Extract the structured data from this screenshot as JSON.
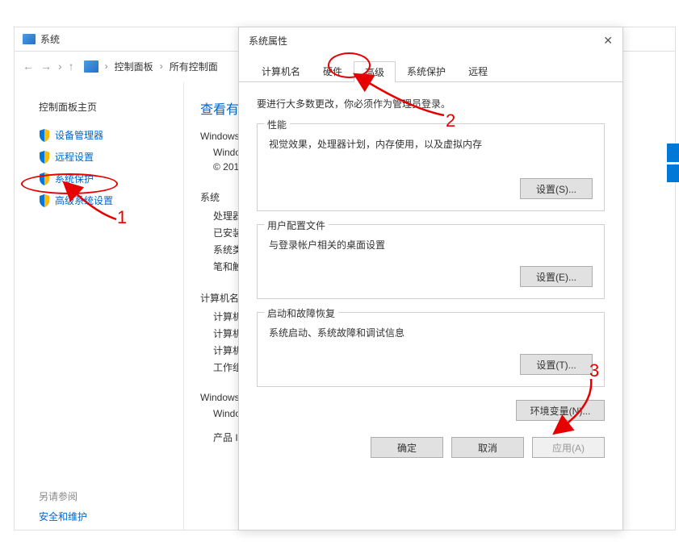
{
  "system_window": {
    "title": "系统",
    "breadcrumb": [
      "控制面板",
      "所有控制面"
    ]
  },
  "sidebar": {
    "home": "控制面板主页",
    "items": [
      {
        "label": "设备管理器"
      },
      {
        "label": "远程设置"
      },
      {
        "label": "系统保护"
      },
      {
        "label": "高级系统设置"
      }
    ],
    "see_also": "另请参阅",
    "see_also_link": "安全和维护"
  },
  "main": {
    "heading": "查看有关",
    "win_edition": "Windows",
    "win_sub1": "Windo",
    "win_sub2": "© 201",
    "system": "系统",
    "system_items": [
      "处理器",
      "已安装",
      "系统类",
      "笔和触"
    ],
    "computer": "计算机名、",
    "computer_items": [
      "计算机",
      "计算机",
      "计算机",
      "工作组"
    ],
    "activation": "Windows",
    "activation_sub": "Windo",
    "product": "产品 II"
  },
  "dialog": {
    "title": "系统属性",
    "tabs": [
      "计算机名",
      "硬件",
      "高级",
      "系统保护",
      "远程"
    ],
    "active_tab": 2,
    "note": "要进行大多数更改，你必须作为管理员登录。",
    "groups": [
      {
        "title": "性能",
        "desc": "视觉效果，处理器计划，内存使用，以及虚拟内存",
        "button": "设置(S)..."
      },
      {
        "title": "用户配置文件",
        "desc": "与登录帐户相关的桌面设置",
        "button": "设置(E)..."
      },
      {
        "title": "启动和故障恢复",
        "desc": "系统启动、系统故障和调试信息",
        "button": "设置(T)..."
      }
    ],
    "env_button": "环境变量(N)...",
    "footer": {
      "ok": "确定",
      "cancel": "取消",
      "apply": "应用(A)"
    }
  },
  "annotations": {
    "n1": "1",
    "n2": "2",
    "n3": "3"
  }
}
